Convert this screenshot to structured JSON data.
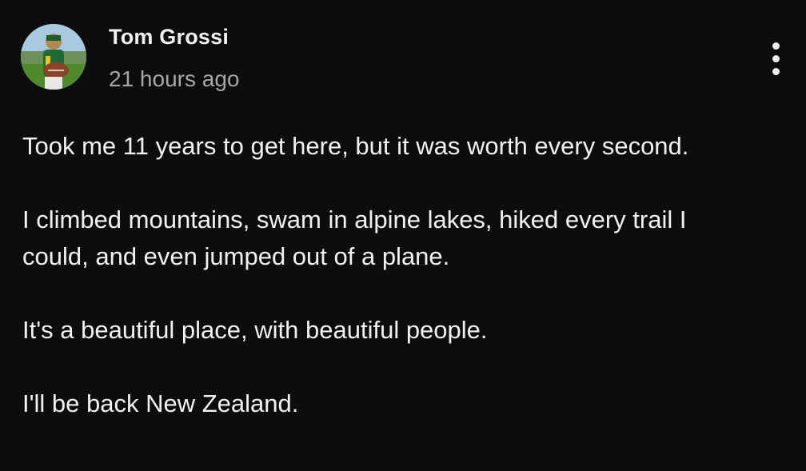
{
  "post": {
    "author": "Tom Grossi",
    "timestamp": "21 hours ago",
    "avatar_icon": "user-avatar-photo",
    "menu_icon": "more-vert-icon",
    "paragraphs": [
      "Took me 11 years to get here, but it was worth every second.",
      "I climbed mountains, swam in alpine lakes, hiked every trail I could, and even jumped out of a plane.",
      "It's a beautiful place, with beautiful people.",
      "I'll be back New Zealand."
    ]
  },
  "colors": {
    "background": "#0d0d0d",
    "text_primary": "#f1f1f1",
    "text_secondary": "#a7a7a7"
  }
}
